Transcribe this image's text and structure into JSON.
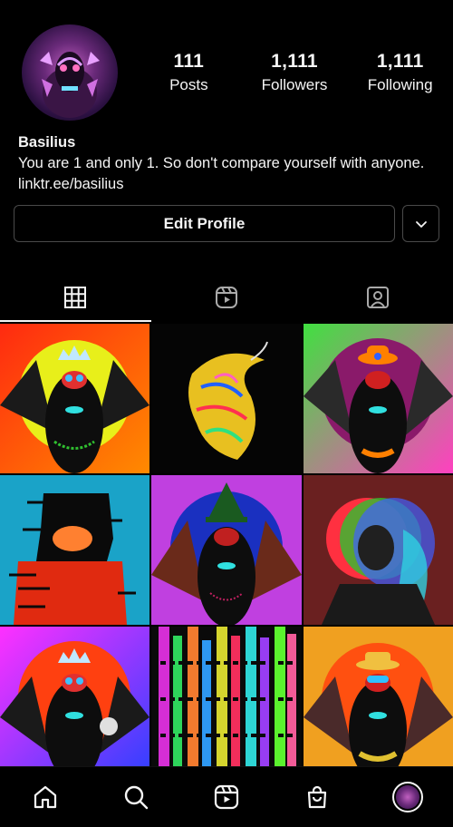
{
  "profile": {
    "username": "Basilius",
    "bio": "You are 1 and only 1. So don't compare yourself with anyone.",
    "link": "linktr.ee/basilius"
  },
  "stats": [
    {
      "value": "111",
      "label": "Posts"
    },
    {
      "value": "1,111",
      "label": "Followers"
    },
    {
      "value": "1,111",
      "label": "Following"
    }
  ],
  "actions": {
    "edit_profile": "Edit Profile"
  },
  "tabs": [
    {
      "icon": "grid-icon",
      "active": true
    },
    {
      "icon": "reels-icon",
      "active": false
    },
    {
      "icon": "tagged-icon",
      "active": false
    }
  ],
  "posts": [
    {
      "bg": "#e83010"
    },
    {
      "bg": "#050505"
    },
    {
      "bg": "#a030e0"
    },
    {
      "bg": "#1aa3c8"
    },
    {
      "bg": "#c040e0"
    },
    {
      "bg": "#6a2020"
    },
    {
      "bg": "#e030e0"
    },
    {
      "bg": "#0a0a0a"
    },
    {
      "bg": "#f0a020"
    }
  ],
  "bottom_nav": [
    "home-icon",
    "search-icon",
    "reels-icon",
    "shop-icon",
    "profile-avatar"
  ]
}
